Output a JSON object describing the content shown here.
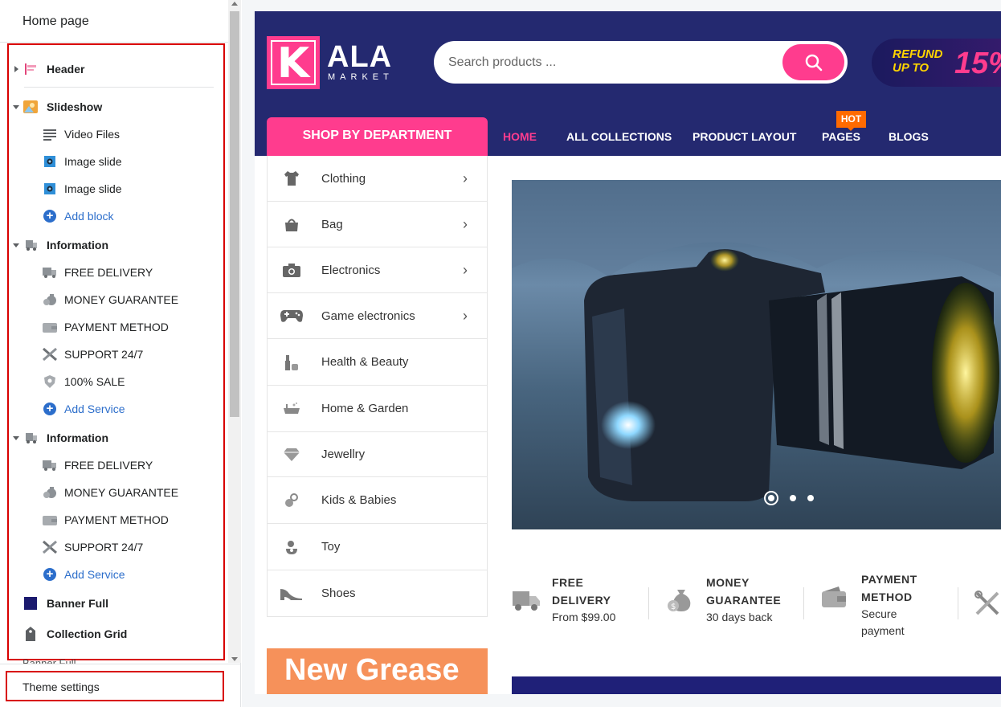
{
  "editor": {
    "title": "Home page",
    "theme_settings": "Theme settings",
    "partial_next_label": "Banner Full",
    "tree": {
      "header": "Header",
      "slideshow": "Slideshow",
      "slideshow_blocks": [
        "Video Files",
        "Image slide",
        "Image slide"
      ],
      "add_block": "Add block",
      "information_1": "Information",
      "information_1_items": [
        "FREE DELIVERY",
        "MONEY GUARANTEE",
        "PAYMENT METHOD",
        "SUPPORT 24/7",
        "100% SALE"
      ],
      "add_service_1": "Add Service",
      "information_2": "Information",
      "information_2_items": [
        "FREE DELIVERY",
        "MONEY GUARANTEE",
        "PAYMENT METHOD",
        "SUPPORT 24/7"
      ],
      "add_service_2": "Add Service",
      "banner_full": "Banner Full",
      "collection_grid": "Collection Grid"
    }
  },
  "store": {
    "logo_letter": "K",
    "logo_name": "ALA",
    "logo_sub": "MARKET",
    "search_placeholder": "Search products ...",
    "promo": {
      "line1": "REFUND",
      "line2": "UP TO",
      "percent": "15%"
    },
    "shop_by_department": "SHOP BY DEPARTMENT",
    "nav": [
      "HOME",
      "ALL COLLECTIONS",
      "PRODUCT LAYOUT",
      "PAGES",
      "BLOGS"
    ],
    "hot_badge": "HOT",
    "categories": [
      "Clothing",
      "Bag",
      "Electronics",
      "Game electronics",
      "Health & Beauty",
      "Home & Garden",
      "Jewellry",
      "Kids & Babies",
      "Toy",
      "Shoes"
    ],
    "services": [
      {
        "title1": "FREE",
        "title2": "DELIVERY",
        "sub1": "From $99.00",
        "sub2": ""
      },
      {
        "title1": "MONEY",
        "title2": "GUARANTEE",
        "sub1": "30 days back",
        "sub2": ""
      },
      {
        "title1": "PAYMENT",
        "title2": "METHOD",
        "sub1": "Secure",
        "sub2": "payment"
      }
    ],
    "banner_text": "New Grease"
  },
  "colors": {
    "brand_navy": "#242970",
    "brand_pink": "#ff3c8e",
    "hot_orange": "#ff6a00",
    "highlight_red": "#d80000",
    "link_blue": "#2c6ecb"
  }
}
